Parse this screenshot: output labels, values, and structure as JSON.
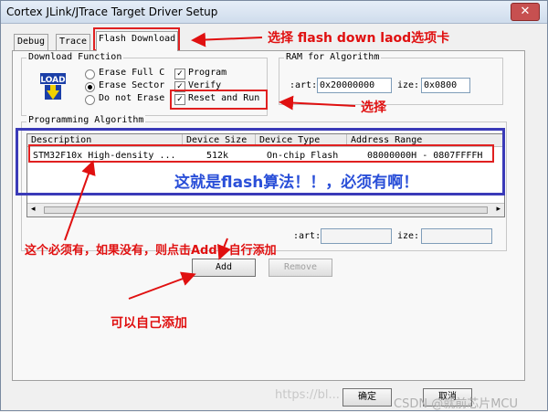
{
  "window": {
    "title": "Cortex JLink/JTrace Target Driver Setup",
    "close_glyph": "✕"
  },
  "tabs": [
    {
      "label": "Debug"
    },
    {
      "label": "Trace"
    },
    {
      "label": "Flash Download"
    }
  ],
  "download_function": {
    "legend": "Download Function",
    "icon_label": "LOAD",
    "radios": [
      {
        "label": "Erase Full C",
        "selected": false
      },
      {
        "label": "Erase Sector",
        "selected": true
      },
      {
        "label": "Do not Erase",
        "selected": false
      }
    ],
    "checks": [
      {
        "label": "Program",
        "checked": true
      },
      {
        "label": "Verify",
        "checked": true
      },
      {
        "label": "Reset and Run",
        "checked": true
      }
    ]
  },
  "ram": {
    "legend": "RAM for Algorithm",
    "start_label": ":art:",
    "start_value": "0x20000000",
    "size_label": "ize:",
    "size_value": "0x0800"
  },
  "algorithm": {
    "legend": "Programming Algorithm",
    "columns": [
      "Description",
      "Device Size",
      "Device Type",
      "Address Range"
    ],
    "rows": [
      [
        "STM32F10x High-density ...",
        "512k",
        "On-chip Flash",
        "08000000H - 0807FFFFH"
      ]
    ],
    "start_label": ":art:",
    "size_label": "ize:",
    "add_label": "Add",
    "remove_label": "Remove"
  },
  "footer": {
    "ok_label": "确定",
    "cancel_label": "取消"
  },
  "annotations": {
    "tab_note": "选择 flash down laod选项卡",
    "reset_note": "选择",
    "table_note": "这就是flash算法！！，必须有啊！",
    "add_note": "这个必须有，如果没有，则点击Add，自行添加",
    "self_add_note": "可以自己添加"
  },
  "watermark": {
    "url": "https://bl...",
    "brand": "CSDN @就前芯片MCU"
  },
  "colors": {
    "annotation_red": "#e01010",
    "highlight_blue": "#3a3ab8"
  }
}
